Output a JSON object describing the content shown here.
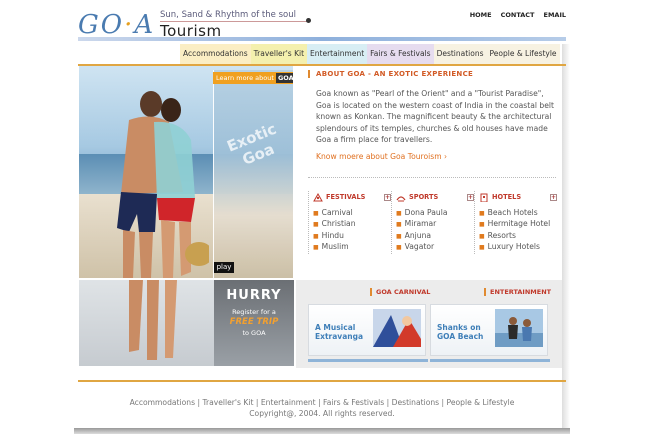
{
  "logo": {
    "mark_left": "G",
    "mark_o": "O",
    "mark_dot": "·",
    "mark_right": "A",
    "tagline": "Sun, Sand & Rhythm of the soul",
    "title": "Tourism"
  },
  "toplinks": [
    "HOME",
    "CONTACT",
    "EMAIL"
  ],
  "nav": [
    {
      "label": "Accommodations",
      "color": "#fbeec4"
    },
    {
      "label": "Traveller's Kit",
      "color": "#f4f0ae"
    },
    {
      "label": "Entertainment",
      "color": "#d8eef4"
    },
    {
      "label": "Fairs & Festivals",
      "color": "#e6dcef"
    },
    {
      "label": "Destinations",
      "color": "#f7f2e2"
    },
    {
      "label": "People & Lifestyle",
      "color": "#f7f2e2"
    }
  ],
  "hero": {
    "learn_more": "Learn more about",
    "learn_more_tag": "GOA",
    "exotic_text": "Exotic Goa",
    "play": "play"
  },
  "promo": {
    "hurry": "HURRY",
    "line1": "Register for a",
    "free_trip": "FREE TRIP",
    "line2": "to GOA"
  },
  "about": {
    "heading": "ABOUT GOA - AN EXOTIC EXPERIENCE",
    "body": "Goa known as \"Pearl of the Orient\" and a \"Tourist Paradise\", Goa is located on the western coast of India in the coastal belt known as Konkan. The magnificent beauty & the architectural splendours of its temples, churches & old houses have made Goa a firm place for travellers.",
    "know_more": "Know moere about Goa Touroism ›"
  },
  "columns": [
    {
      "title": "FESTIVALS",
      "icon": "festival-icon",
      "items": [
        "Carnival",
        "Christian",
        "Hindu",
        "Muslim"
      ]
    },
    {
      "title": "SPORTS",
      "icon": "sports-icon",
      "items": [
        "Dona Paula",
        "Miramar",
        "Anjuna",
        "Vagator"
      ]
    },
    {
      "title": "HOTELS",
      "icon": "hotel-icon",
      "items": [
        "Beach Hotels",
        "Hermitage Hotel",
        "Resorts",
        "Luxury Hotels"
      ]
    }
  ],
  "panels": {
    "carnival_head": "GOA CARNIVAL",
    "entertainment_head": "ENTERTAINMENT",
    "card1": "A Musical Extravanga",
    "card2": "Shanks on GOA Beach"
  },
  "footer": {
    "links": [
      "Accommodations",
      "Traveller's Kit",
      "Entertainment",
      "Fairs & Festivals",
      "Destinations",
      "People & Lifestyle"
    ],
    "separator": " | ",
    "copyright": "Copyright@, 2004. All rights reserved."
  },
  "colors": {
    "accent": "#e07020",
    "heading": "#d25b26",
    "link_blue": "#3f7fb8"
  }
}
